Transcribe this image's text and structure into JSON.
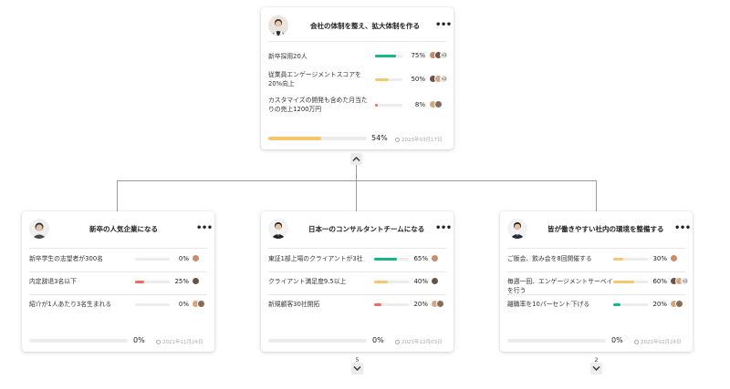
{
  "colors": {
    "green": "#16b58a",
    "yellow": "#f5c86e",
    "red": "#ef6b5e",
    "track": "#ececec"
  },
  "root": {
    "title": "会社の体制を整え、拡大体制を作る",
    "menu": "•••",
    "key_results": [
      {
        "label": "新卒採用20人",
        "percent_text": "75%",
        "value": 75,
        "color": "green",
        "extra": "+3"
      },
      {
        "label": "従業員エンゲージメントスコアを20%向上",
        "percent_text": "50%",
        "value": 50,
        "color": "yellow",
        "extra": "+2"
      },
      {
        "label": "カスタマイズの開発も含めた月当たりの売上1200万円",
        "percent_text": "8%",
        "value": 8,
        "color": "red",
        "extra": ""
      }
    ],
    "progress_text": "54%",
    "progress_value": 54,
    "progress_color": "yellow",
    "date": "2023年03月17日"
  },
  "children": [
    {
      "title": "新卒の人気企業になる",
      "menu": "•••",
      "key_results": [
        {
          "label": "新卒学生の志望者が300名",
          "percent_text": "0%",
          "value": 0,
          "color": "green"
        },
        {
          "label": "内定辞退3名以下",
          "percent_text": "25%",
          "value": 25,
          "color": "red"
        },
        {
          "label": "紹介が1人あたり3名生まれる",
          "percent_text": "0%",
          "value": 0,
          "color": "green"
        }
      ],
      "progress_text": "0%",
      "progress_value": 0,
      "date": "2021年11月24日"
    },
    {
      "title": "日本一のコンサルタントチームになる",
      "menu": "•••",
      "key_results": [
        {
          "label": "東証1部上場のクライアントが3社",
          "percent_text": "65%",
          "value": 65,
          "color": "green"
        },
        {
          "label": "クライアント満足度9.5以上",
          "percent_text": "40%",
          "value": 40,
          "color": "yellow"
        },
        {
          "label": "新規顧客30社開拓",
          "percent_text": "20%",
          "value": 20,
          "color": "red"
        }
      ],
      "progress_text": "0%",
      "progress_value": 0,
      "date": "2021年12月03日",
      "child_count": "5"
    },
    {
      "title": "皆が働きやすい社内の環境を整備する",
      "menu": "•••",
      "key_results": [
        {
          "label": "ご飯会、飲み会を8回開催する",
          "percent_text": "30%",
          "value": 30,
          "color": "yellow"
        },
        {
          "label": "毎週一回、エンゲージメントサーベイを行う",
          "percent_text": "60%",
          "value": 60,
          "color": "yellow",
          "extra": "+2"
        },
        {
          "label": "離職率を10パーセント下げる",
          "percent_text": "20%",
          "value": 20,
          "color": "green"
        }
      ],
      "progress_text": "0%",
      "progress_value": 0,
      "date": "2022年02月24日",
      "child_count": "2"
    }
  ]
}
